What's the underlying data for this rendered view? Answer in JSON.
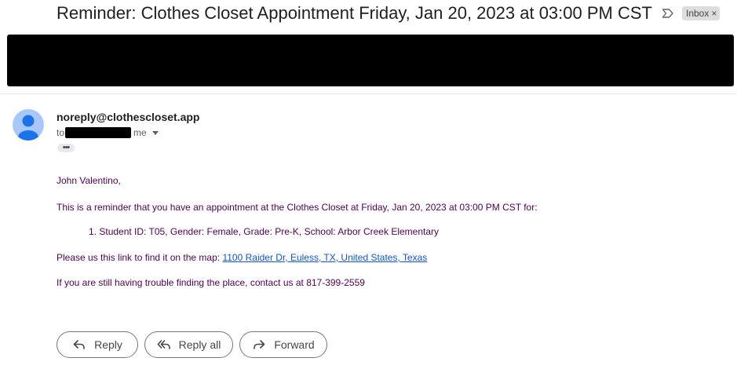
{
  "email": {
    "subject": "Reminder: Clothes Closet Appointment Friday, Jan 20, 2023 at 03:00 PM CST",
    "label_icon": "label-arrow-icon",
    "inbox_badge": "Inbox",
    "badge_close": "×"
  },
  "sender": {
    "email": "noreply@clothescloset.app",
    "to_prefix": "to",
    "to_me": "me",
    "avatar_icon": "person-icon",
    "ellipsis": "•••"
  },
  "body": {
    "greeting": "John Valentino,",
    "reminder": "This is a reminder that you have an appointment at the Clothes Closet at Friday, Jan 20, 2023 at 03:00 PM CST for:",
    "list_number": "1.",
    "list_item": "Student ID: T05, Gender: Female, Grade: Pre-K, School: Arbor Creek Elementary",
    "map_prefix": "Please us this link to find it on the map:",
    "map_link": "1100 Raider Dr, Euless, TX, United States, Texas",
    "contact": "If you are still having trouble finding the place, contact us at 817-399-2559"
  },
  "actions": {
    "reply": "Reply",
    "reply_all": "Reply all",
    "forward": "Forward"
  },
  "colors": {
    "body_text": "#500050",
    "link": "#1155cc",
    "avatar_bg": "#a8c7fa",
    "avatar_fg": "#1a73e8"
  }
}
